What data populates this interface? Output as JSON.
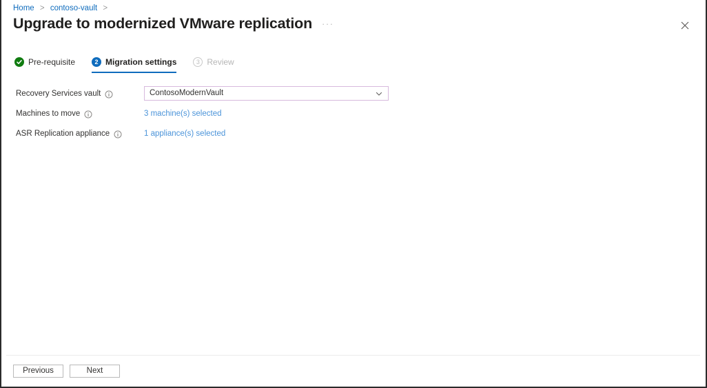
{
  "breadcrumb": {
    "items": [
      {
        "label": "Home"
      },
      {
        "label": "contoso-vault"
      }
    ],
    "separator": ">"
  },
  "header": {
    "title": "Upgrade to modernized VMware replication",
    "more_menu": "···",
    "close_icon": "close-icon"
  },
  "wizard": {
    "tabs": [
      {
        "label": "Pre-requisite",
        "state": "completed",
        "badge": "✓"
      },
      {
        "label": "Migration settings",
        "state": "active",
        "badge": "2"
      },
      {
        "label": "Review",
        "state": "disabled",
        "badge": "3"
      }
    ]
  },
  "form": {
    "fields": [
      {
        "label": "Recovery Services vault",
        "type": "select",
        "value": "ContosoModernVault",
        "info_icon": "info-icon"
      },
      {
        "label": "Machines to move",
        "type": "link",
        "value": "3 machine(s) selected",
        "info_icon": "info-icon"
      },
      {
        "label": "ASR Replication appliance",
        "type": "link",
        "value": "1 appliance(s) selected",
        "info_icon": "info-icon"
      }
    ]
  },
  "footer": {
    "previous_label": "Previous",
    "next_label": "Next"
  },
  "colors": {
    "link": "#0f6cbd",
    "value_link": "#4a93d9",
    "accent": "#0f6cbd",
    "success": "#107c10",
    "select_border": "#d7b9dd"
  }
}
